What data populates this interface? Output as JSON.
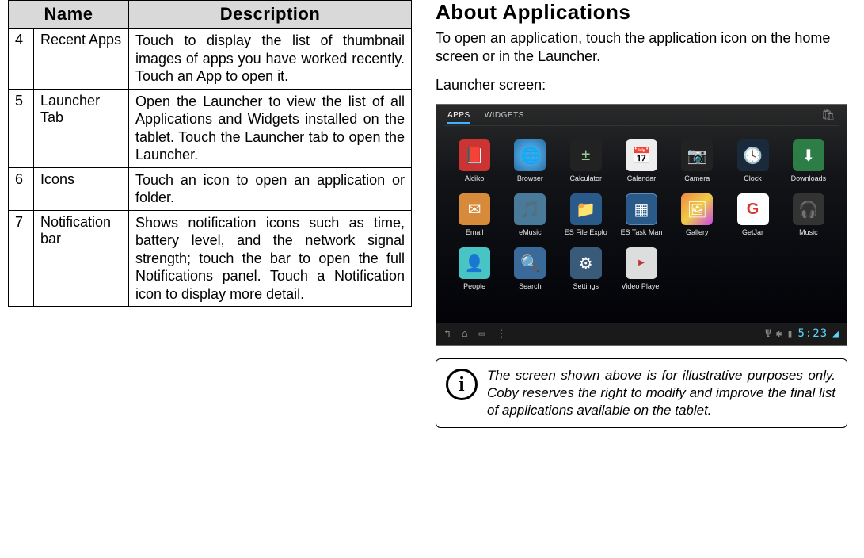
{
  "table": {
    "headers": {
      "name": "Name",
      "description": "Description"
    },
    "rows": [
      {
        "num": "4",
        "name": "Recent Apps",
        "desc": "Touch to display the list of thumbnail images of apps you have worked recently. Touch an App to open it."
      },
      {
        "num": "5",
        "name": "Launcher Tab",
        "desc": "Open the Launcher to view the list of all Applications and Widgets installed on the tablet. Touch the Launcher tab to open the Launcher."
      },
      {
        "num": "6",
        "name": "Icons",
        "desc": "Touch an icon to open an application or folder."
      },
      {
        "num": "7",
        "name": "Notification bar",
        "desc": "Shows notification icons such as time, battery level, and the network signal strength; touch the bar to open the full Notifications panel. Touch a Notification icon to display more detail."
      }
    ]
  },
  "about": {
    "heading": "About Applications",
    "intro": "To open an application, touch the application icon on the home screen or in the Launcher.",
    "caption": "Launcher screen:"
  },
  "launcher": {
    "tabs": {
      "apps": "APPS",
      "widgets": "WIDGETS"
    },
    "clock": "5:23",
    "apps": [
      {
        "label": "Aldiko",
        "glyph": "📕",
        "cls": "ic-aldiko"
      },
      {
        "label": "Browser",
        "glyph": "🌐",
        "cls": "ic-browser"
      },
      {
        "label": "Calculator",
        "glyph": "±",
        "cls": "ic-calc"
      },
      {
        "label": "Calendar",
        "glyph": "📅",
        "cls": "ic-calendar"
      },
      {
        "label": "Camera",
        "glyph": "📷",
        "cls": "ic-camera"
      },
      {
        "label": "Clock",
        "glyph": "🕓",
        "cls": "ic-clock"
      },
      {
        "label": "Downloads",
        "glyph": "⬇",
        "cls": "ic-downloads"
      },
      {
        "label": "Email",
        "glyph": "✉",
        "cls": "ic-email"
      },
      {
        "label": "eMusic",
        "glyph": "🎵",
        "cls": "ic-emusic"
      },
      {
        "label": "ES File Explo",
        "glyph": "📁",
        "cls": "ic-esfile"
      },
      {
        "label": "ES Task Man",
        "glyph": "▦",
        "cls": "ic-estask"
      },
      {
        "label": "Gallery",
        "glyph": "🖼",
        "cls": "ic-gallery"
      },
      {
        "label": "GetJar",
        "glyph": "G",
        "cls": "ic-getjar"
      },
      {
        "label": "Music",
        "glyph": "🎧",
        "cls": "ic-music"
      },
      {
        "label": "People",
        "glyph": "👤",
        "cls": "ic-people"
      },
      {
        "label": "Search",
        "glyph": "🔍",
        "cls": "ic-search"
      },
      {
        "label": "Settings",
        "glyph": "⚙",
        "cls": "ic-settings"
      },
      {
        "label": "Video Player",
        "glyph": "▶",
        "cls": "ic-video"
      }
    ]
  },
  "note": {
    "text": "The screen shown above is for illustrative purposes only. Coby reserves the right to modify  and improve the final list of applications available on the tablet."
  }
}
